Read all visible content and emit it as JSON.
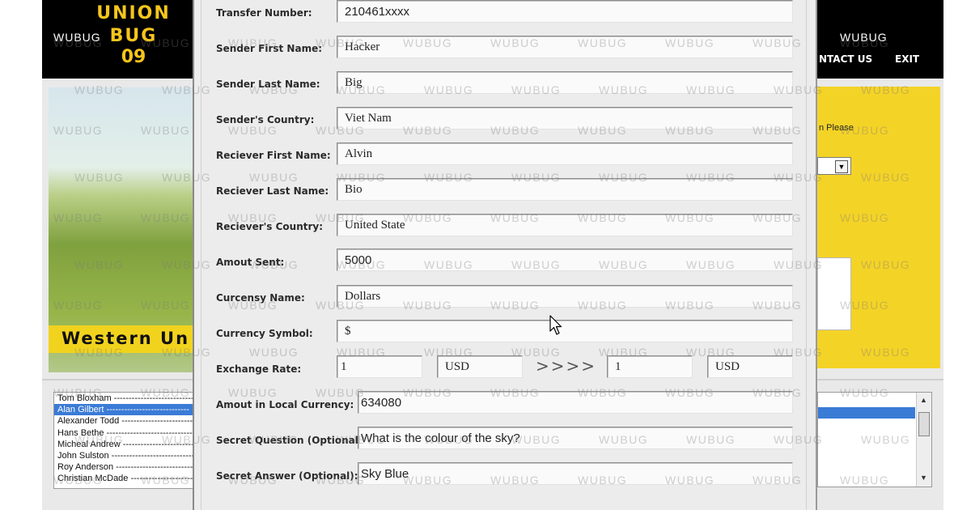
{
  "background_app": {
    "logo": {
      "line1": "UNION",
      "line2": "BUG",
      "line3": "09"
    },
    "topbar_brand": [
      "WUBUG",
      "WUBUG"
    ],
    "nav": {
      "contact": "NTACT US",
      "exit": "EXIT"
    },
    "banner": "Western Un",
    "yellow_panel_text": "n Please",
    "names_list": [
      "Tom Bloxham ---------------------------",
      "Alan Gilbert ----------------------------",
      "Alexander Todd -------------------------",
      "Hans Bethe -----------------------------",
      "Micheal Andrew -------------------------",
      "John Sulston ----------------------------",
      "Roy Anderson ---------------------------",
      "Christian McDade ------------------------"
    ],
    "selected_index": 1
  },
  "form": {
    "transfer_number": {
      "label": "Transfer Number:",
      "value": "210461xxxx"
    },
    "sender_first": {
      "label": "Sender First Name:",
      "value": "Hacker"
    },
    "sender_last": {
      "label": "Sender Last Name:",
      "value": "Big"
    },
    "sender_country": {
      "label": "Sender's Country:",
      "value": "Viet Nam"
    },
    "receiver_first": {
      "label": "Reciever First Name:",
      "value": "Alvin"
    },
    "receiver_last": {
      "label": "Reciever Last Name:",
      "value": "Bio"
    },
    "receiver_country": {
      "label": "Reciever's Country:",
      "value": "United State"
    },
    "amount_sent": {
      "label": "Amout Sent:",
      "value": "5000"
    },
    "currency_name": {
      "label": "Curcensy Name:",
      "value": "Dollars"
    },
    "currency_symbol": {
      "label": "Currency Symbol:",
      "value": "$"
    },
    "exchange_rate": {
      "label": "Exchange Rate:",
      "from_amount": "1",
      "from_currency": "USD",
      "arrows": ">>>>",
      "to_amount": "1",
      "to_currency": "USD"
    },
    "local_amount": {
      "label": "Amout in Local Currency:",
      "value": "634080"
    },
    "secret_question": {
      "label": "Secret Question (Optional):",
      "value": "What is the colour of the sky?"
    },
    "secret_answer": {
      "label": "Secret Answer (Optional):",
      "value": "Sky Blue"
    }
  },
  "watermark": "WUBUG",
  "icons": {
    "cursor": "mouse-pointer-icon",
    "dropdown": "chevron-down-icon",
    "scroll_up": "arrow-up-icon",
    "scroll_down": "arrow-down-icon"
  }
}
